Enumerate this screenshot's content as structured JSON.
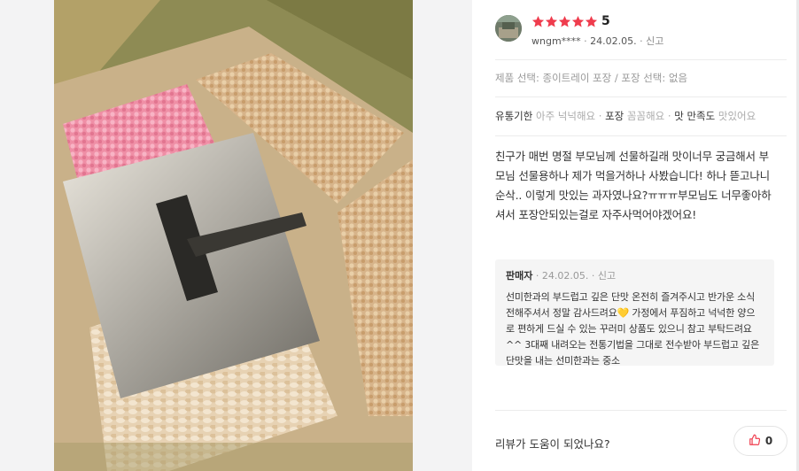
{
  "review": {
    "rating": "5",
    "stars_filled": 5,
    "username": "wngm****",
    "separator": "·",
    "date": "24.02.05.",
    "report_label": "신고",
    "option_text": "제품 선택: 종이트레이 포장 / 포장 선택: 없음",
    "evaluations": [
      {
        "key": "유통기한",
        "value": "아주 넉넉해요"
      },
      {
        "key": "포장",
        "value": "꼼꼼해요"
      },
      {
        "key": "맛 만족도",
        "value": "맛있어요"
      }
    ],
    "body": "친구가 매번 명절 부모님께 선물하길래 맛이너무 궁금해서 부모님 선물용하나 제가 먹을거하나 사봤습니다! 하나 뜯고나니 순삭.. 이렇게 맛있는 과자였나요?ㅠㅠㅠ부모님도 너무좋아하셔서 포장안되있는걸로 자주사먹어야겠어요!"
  },
  "seller_reply": {
    "label": "판매자",
    "date": "24.02.05.",
    "report_label": "신고",
    "text": "선미한과의 부드럽고 깊은 단맛 온전히 즐겨주시고 반가운 소식 전해주셔서 정말 감사드려요💛 가정에서 푸짐하고 넉넉한 양으로 편하게 드실 수 있는 꾸러미 상품도 있으니 참고 부탁드려요^^ 3대째 내려오는 전통기법을 그대로 전수받아 부드럽고 깊은 단맛을 내는 선미한과는 중소"
  },
  "footer": {
    "question": "리뷰가 도움이 되었나요?",
    "like_count": "0"
  },
  "colors": {
    "star": "#ef3c4d",
    "heart": "#f2c94c"
  },
  "icons": {
    "star": "star-icon",
    "like": "thumbs-up-icon"
  }
}
